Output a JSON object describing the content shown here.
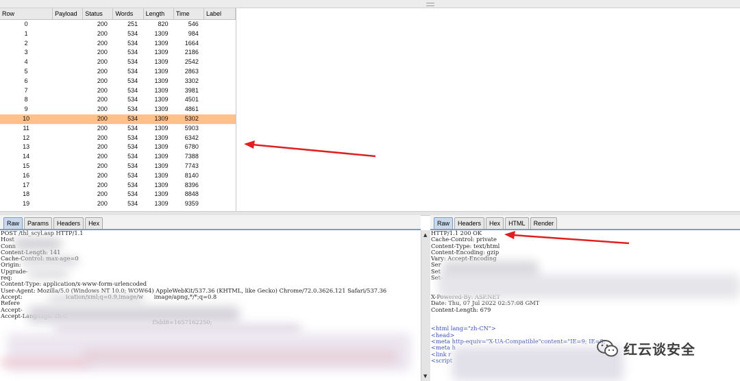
{
  "results": {
    "columns": [
      "Row",
      "Payload",
      "Status",
      "Words",
      "Length",
      "Time",
      "Label"
    ],
    "selected_row": "10",
    "rows": [
      {
        "row": "0",
        "payload": "",
        "status": "200",
        "words": "251",
        "length": "820",
        "time": "546",
        "label": ""
      },
      {
        "row": "1",
        "payload": "",
        "status": "200",
        "words": "534",
        "length": "1309",
        "time": "984",
        "label": ""
      },
      {
        "row": "2",
        "payload": "",
        "status": "200",
        "words": "534",
        "length": "1309",
        "time": "1664",
        "label": ""
      },
      {
        "row": "3",
        "payload": "",
        "status": "200",
        "words": "534",
        "length": "1309",
        "time": "2186",
        "label": ""
      },
      {
        "row": "4",
        "payload": "",
        "status": "200",
        "words": "534",
        "length": "1309",
        "time": "2542",
        "label": ""
      },
      {
        "row": "5",
        "payload": "",
        "status": "200",
        "words": "534",
        "length": "1309",
        "time": "2863",
        "label": ""
      },
      {
        "row": "6",
        "payload": "",
        "status": "200",
        "words": "534",
        "length": "1309",
        "time": "3302",
        "label": ""
      },
      {
        "row": "7",
        "payload": "",
        "status": "200",
        "words": "534",
        "length": "1309",
        "time": "3981",
        "label": ""
      },
      {
        "row": "8",
        "payload": "",
        "status": "200",
        "words": "534",
        "length": "1309",
        "time": "4501",
        "label": ""
      },
      {
        "row": "9",
        "payload": "",
        "status": "200",
        "words": "534",
        "length": "1309",
        "time": "4861",
        "label": ""
      },
      {
        "row": "10",
        "payload": "",
        "status": "200",
        "words": "534",
        "length": "1309",
        "time": "5302",
        "label": ""
      },
      {
        "row": "11",
        "payload": "",
        "status": "200",
        "words": "534",
        "length": "1309",
        "time": "5903",
        "label": ""
      },
      {
        "row": "12",
        "payload": "",
        "status": "200",
        "words": "534",
        "length": "1309",
        "time": "6342",
        "label": ""
      },
      {
        "row": "13",
        "payload": "",
        "status": "200",
        "words": "534",
        "length": "1309",
        "time": "6780",
        "label": ""
      },
      {
        "row": "14",
        "payload": "",
        "status": "200",
        "words": "534",
        "length": "1309",
        "time": "7388",
        "label": ""
      },
      {
        "row": "15",
        "payload": "",
        "status": "200",
        "words": "534",
        "length": "1309",
        "time": "7743",
        "label": ""
      },
      {
        "row": "16",
        "payload": "",
        "status": "200",
        "words": "534",
        "length": "1309",
        "time": "8140",
        "label": ""
      },
      {
        "row": "17",
        "payload": "",
        "status": "200",
        "words": "534",
        "length": "1309",
        "time": "8396",
        "label": ""
      },
      {
        "row": "18",
        "payload": "",
        "status": "200",
        "words": "534",
        "length": "1309",
        "time": "8848",
        "label": ""
      },
      {
        "row": "19",
        "payload": "",
        "status": "200",
        "words": "534",
        "length": "1309",
        "time": "9359",
        "label": ""
      }
    ]
  },
  "request": {
    "tabs": [
      "Raw",
      "Params",
      "Headers",
      "Hex"
    ],
    "active_tab": "Raw",
    "lines": [
      "POST /thl_scyl.asp HTTP/1.1",
      "Host",
      "Conn",
      "Content-Length: 141",
      "Cache-Control: max-age=0",
      "Origin:",
      "Upgrade-",
      "req:",
      "Content-Type: application/x-www-form-urlencoded",
      "User-Agent: Mozilla/5.0 (Windows NT 10.0; WOW64) AppleWebKit/537.36 (KHTML, like Gecko) Chrome/72.0.3626.121 Safari/537.36",
      "Accept:                        ication/xml;q=0.9,image/w      image/apng,*/*;q=0.8",
      "Refere",
      "Accept-",
      "Accept-Language: zh-C",
      "                                                                                    f5dd8=1657162250;"
    ]
  },
  "response": {
    "tabs": [
      "Raw",
      "Headers",
      "Hex",
      "HTML",
      "Render"
    ],
    "active_tab": "Raw",
    "lines": [
      "HTTP/1.1 200 OK",
      "Cache-Control: private",
      "Content-Type: text/html",
      "Content-Encoding: gzip",
      "Vary: Accept-Encoding",
      "Ser",
      "Set",
      "Set-",
      "",
      "",
      "X-Powered-By: ASP.NET",
      "Date: Thu, 07 Jul 2022 02:57:08 GMT",
      "Content-Length: 679",
      "",
      "",
      "<html lang=\"zh-CN\">",
      "<head>",
      "<meta http-equiv=\"X-UA-Compatible\"content=\"IE=9; IE=8;",
      "<meta h",
      "<link r",
      "<script"
    ]
  },
  "watermark": {
    "icon": "wechat-icon",
    "text": "红云谈安全"
  },
  "colors": {
    "selected_row": "#ffc08a",
    "arrow": "#e02020",
    "tab_active": "#c9d8ea"
  }
}
